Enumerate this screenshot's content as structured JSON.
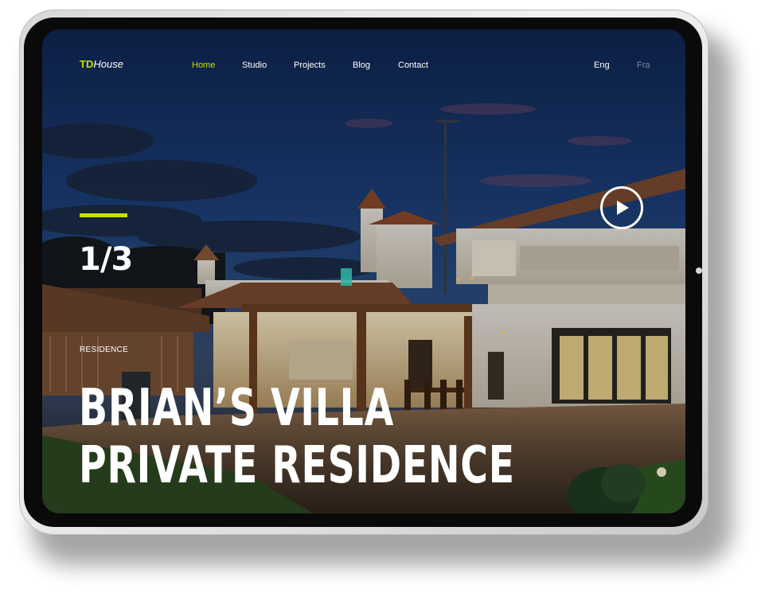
{
  "brand": {
    "logo_prefix": "TD",
    "logo_suffix": "House",
    "accent_color": "#c5e000"
  },
  "nav": {
    "items": [
      {
        "label": "Home",
        "active": true
      },
      {
        "label": "Studio",
        "active": false
      },
      {
        "label": "Projects",
        "active": false
      },
      {
        "label": "Blog",
        "active": false
      },
      {
        "label": "Contact",
        "active": false
      }
    ]
  },
  "languages": [
    {
      "label": "Eng",
      "active": true
    },
    {
      "label": "Fra",
      "active": false
    }
  ],
  "hero": {
    "slide_counter": "1/3",
    "category": "RESIDENCE",
    "title_line1": "BRIAN’S VILLA",
    "title_line2": "PRIVATE RESIDENCE",
    "play_icon": "play-icon"
  }
}
